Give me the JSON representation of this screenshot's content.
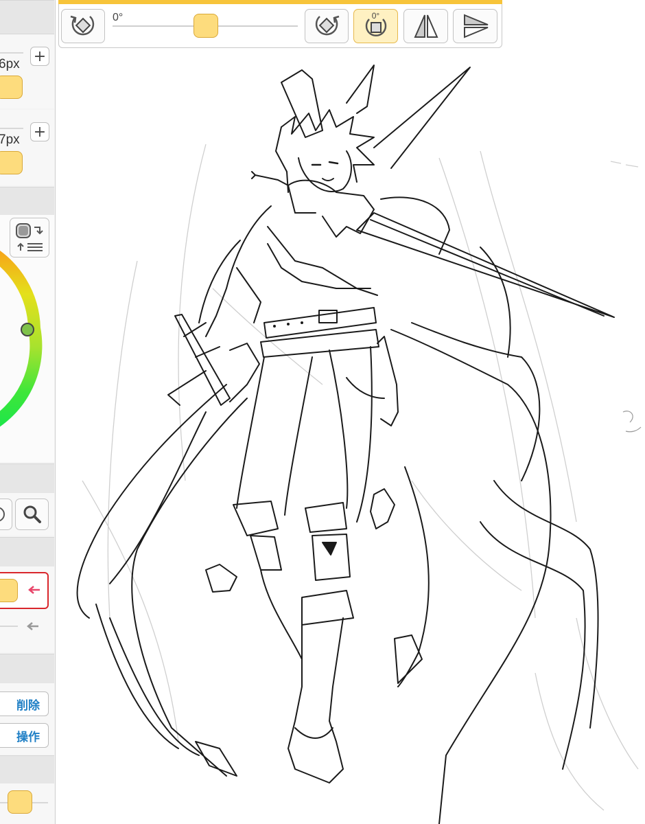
{
  "left_panel": {
    "brush_size_1": "6px",
    "brush_size_2": "7px",
    "plus_label": "+",
    "delete_label": "削除",
    "operation_label": "操作"
  },
  "toolbar": {
    "angle_label": "0°",
    "angle_value": 0,
    "reset_label": "0°"
  },
  "colors": {
    "accent": "#f7c43a",
    "thumb": "#fddc7d",
    "selected_border": "#d9262b",
    "arrow_active": "#e8466a",
    "button_text": "#1f7fc5",
    "color_wheel_indicator": "#7fc24a"
  },
  "icons": {
    "rotate_left": "rotate-left-icon",
    "rotate_right": "rotate-right-icon",
    "reset_rotation": "reset-rotation-icon",
    "flip_horizontal": "flip-horizontal-icon",
    "flip_vertical": "flip-vertical-icon",
    "color_swap": "color-swap-icon",
    "zoom": "magnifier-icon",
    "back_arrow": "arrow-left-icon"
  }
}
